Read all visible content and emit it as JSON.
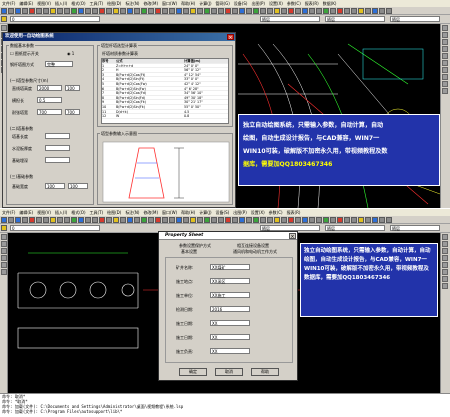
{
  "top": {
    "menu": [
      "文件(F)",
      "编辑(E)",
      "视图(V)",
      "插入(I)",
      "格式(O)",
      "工具(T)",
      "绘图(D)",
      "标注(N)",
      "修改(M)",
      "窗口(W)",
      "帮助(H)",
      "计算(J)",
      "管网(G)",
      "设备(S)",
      "出图(P)",
      "设置(X)",
      "参数(C)",
      "报表(R)",
      "数据(K)"
    ],
    "layer_dropdown": "0",
    "line_dropdown": "随层",
    "dialog": {
      "title": "欢迎使用--自动绘图系统",
      "left_group": "数据基本参数",
      "checkbox_label": "图纸提示开关",
      "radio_label": "1",
      "field_label_1": "钢杆塔图方式",
      "field_value_1": "完整",
      "sub_group_1": "(一)塔型参数尺寸(m)",
      "rows_1": [
        {
          "label": "直线塔高度",
          "value": "2000",
          "value2": "100"
        },
        {
          "label": "横担长",
          "value": "0.5"
        },
        {
          "label": "耐张塔宽",
          "value": "700",
          "value2": "700"
        }
      ],
      "sub_group_2": "(二)塔基参数",
      "rows_2": [
        {
          "label": "塔基长度",
          "value": ""
        },
        {
          "label": "水泥板厚度",
          "value": ""
        },
        {
          "label": "基础埋深",
          "value": ""
        }
      ],
      "sub_group_3": "(三)基础参数",
      "rows_3": [
        {
          "label": "基础宽度",
          "value": "100",
          "value2": "100"
        }
      ],
      "table_group": "塔型杆塔选型计算表",
      "table_caption": "杆塔材质参数计算表",
      "table_headers": [
        "序号",
        "公式",
        "计算值(m)"
      ],
      "table_rows": [
        [
          "1",
          "Z=H+n+d",
          "24° 0' 0\""
        ],
        [
          "2",
          "H",
          "56° 0' 12\""
        ],
        [
          "3",
          "B(Fw+d/2)Cos(Ft)",
          "4° 12' 54\""
        ],
        [
          "4",
          "B(Fw+d/2)Sin(Ft)",
          "33° 0' 0\""
        ],
        [
          "5",
          "B(Fw+d/2)Cos(Fw)",
          "42° 4' 12\""
        ],
        [
          "6",
          "B(Fw+d/2)Sin(Fw)",
          "4° 6' 28\""
        ],
        [
          "7",
          "B(Fw+d/2)Cos(Fd)",
          "34° 56' 10\""
        ],
        [
          "8",
          "B(Fw+d/2)Sin(Fd)",
          "49° 30' 18\""
        ],
        [
          "9",
          "B(Fw+d/2)Cos(Fk)",
          "30° 21' 17\""
        ],
        [
          "10",
          "B(Fw+d/2)Sin(Fk)",
          "55° 0' 50\""
        ],
        [
          "11",
          "D(d+k)",
          "4.5"
        ],
        [
          "12",
          "W",
          "0.8"
        ]
      ],
      "preview_group": "塔型参数输入示意图"
    },
    "ad_text_1": "独立自动绘图系统，只需输入参数，自动计算，自动",
    "ad_text_2": "绘图，自动生成设计报告，与CAD兼容，WIN7一",
    "ad_text_3": "WIN10可装，破解版不加密永久用，带视频教程及数",
    "ad_text_4": "据库，需要加QQ1803467346"
  },
  "bottom": {
    "menu": [
      "文件(F)",
      "编辑(E)",
      "视图(V)",
      "插入(I)",
      "格式(O)",
      "工具(T)",
      "绘图(D)",
      "标注(N)",
      "修改(M)",
      "窗口(W)",
      "帮助(H)",
      "计算(J)",
      "设备(S)",
      "出图(P)",
      "设置(X)",
      "参数(C)",
      "报表(R)"
    ],
    "layer_dropdown": "0",
    "line_dropdown": "随层",
    "prop_dialog": {
      "title": "Property Sheet",
      "tab_1": "参数设置保护方式",
      "tab_1b": "基本设置",
      "tab_2": "相互连接设备设置",
      "tab_2b": "通风机和电动机工作方式",
      "fields": [
        {
          "label": "矿井名称:",
          "value": "XX煤矿"
        },
        {
          "label": "施工地点:",
          "value": "XX采区"
        },
        {
          "label": "施工单位:",
          "value": "XX施工"
        },
        {
          "label": "检测日期:",
          "value": "2016"
        },
        {
          "label": "施工日期:",
          "value": "XX"
        },
        {
          "label": "施工日期:",
          "value": "XX"
        },
        {
          "label": "施工负责:",
          "value": "XX"
        }
      ],
      "ok": "确定",
      "cancel": "取消",
      "help": "帮助"
    },
    "ad_text": "独立自动绘图系统，只需输入参数，自动计算，自动绘图，自动生成设计报告，与CAD兼容，WIN7一WIN10可装，破解版不加密永久用，带视频教程及数据库，需要加QQ1803467346",
    "cmd_lines": [
      "命令: 取消*",
      "命令: *取消*",
      "命令: 加载(文件): C:\\Documents and Settings\\Administrator\\桌面\\视频教程\\系统.lsp",
      "命令: 加载(文件): C:\\Program Files\\autosupport\\lib\\*"
    ]
  },
  "colors": {
    "canvas": "#000000",
    "ad_bg": "#2233aa",
    "ad_text": "#ffffff",
    "ad_highlight": "#ffff00",
    "title_bar": "#0a246a"
  }
}
